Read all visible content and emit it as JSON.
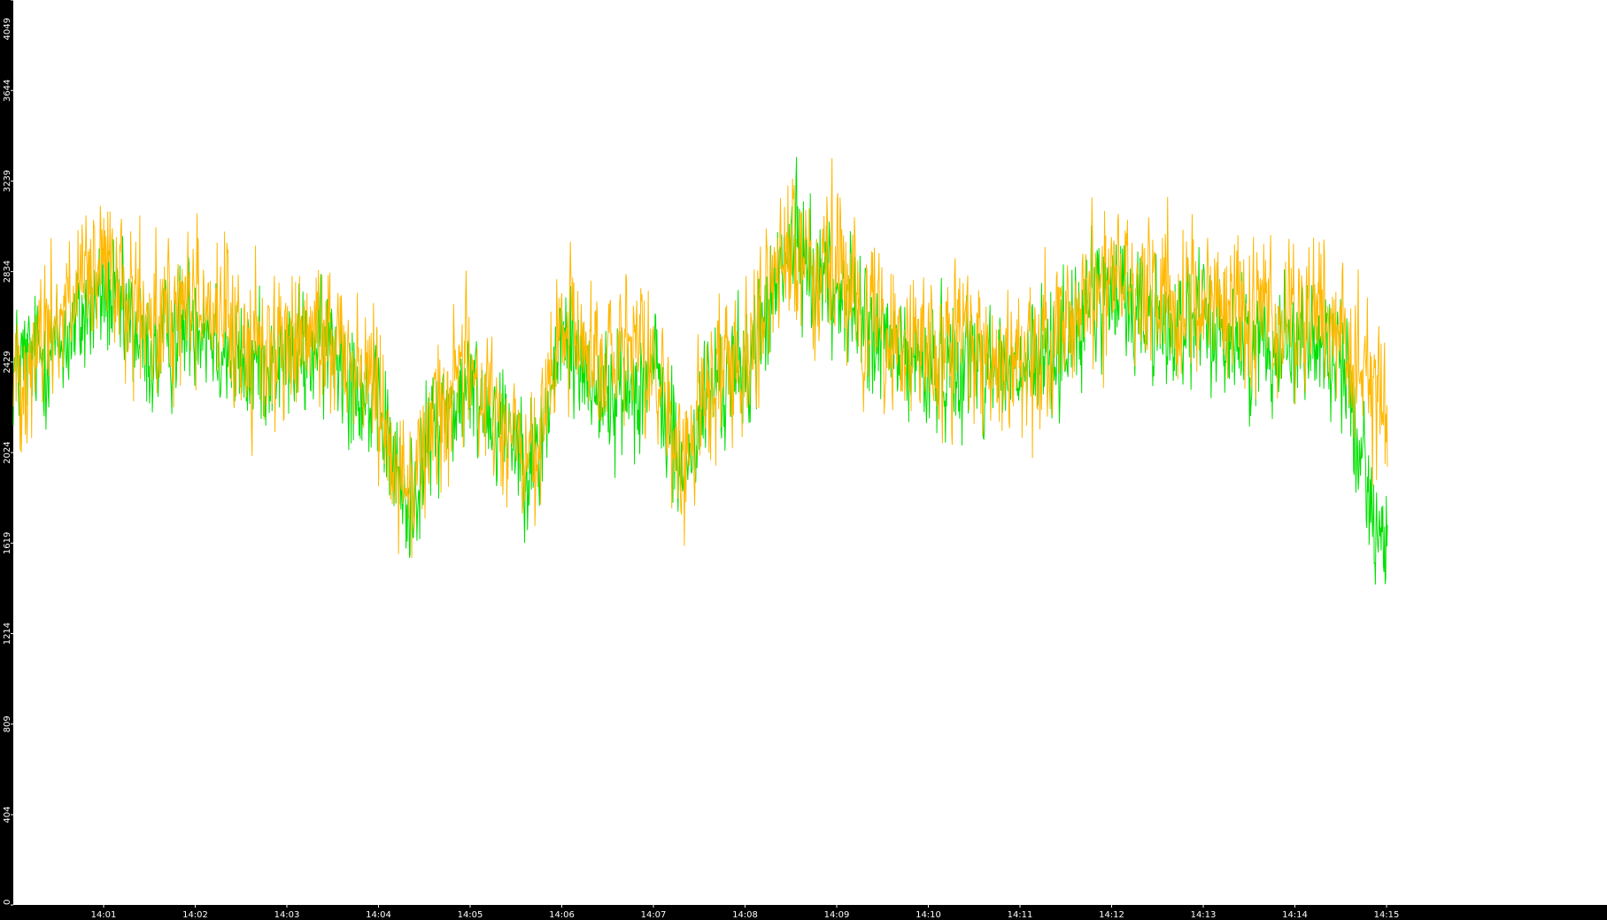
{
  "chart_data": {
    "type": "line",
    "title": "",
    "xlabel": "",
    "ylabel": "",
    "grid": false,
    "legend": "none",
    "background": "#ffffff",
    "frame_color": "#000000",
    "y_ticks": [
      0,
      404,
      809,
      1214,
      1619,
      2024,
      2429,
      2834,
      3239,
      3644,
      4049
    ],
    "y_tick_labels": [
      "0",
      "404",
      "809",
      "1214",
      "1619",
      "2024",
      "2429",
      "2834",
      "3239",
      "3644",
      "4049"
    ],
    "ylim": [
      0,
      4049
    ],
    "x_tick_labels": [
      "14:01",
      "14:02",
      "14:03",
      "14:04",
      "14:05",
      "14:06",
      "14:07",
      "14:08",
      "14:09",
      "14:10",
      "14:11",
      "14:12",
      "14:13",
      "14:14",
      "14:15"
    ],
    "x_ticks_minutes": [
      1,
      2,
      3,
      4,
      5,
      6,
      7,
      8,
      9,
      10,
      11,
      12,
      13,
      14,
      15
    ],
    "xlim_minutes": [
      0.0,
      15.0
    ],
    "samples_per_minute": 160,
    "series": [
      {
        "color": "#00e000",
        "envelope_minutes": [
          0.0,
          0.5,
          1.0,
          1.5,
          2.0,
          2.5,
          3.0,
          3.5,
          4.0,
          4.3,
          4.6,
          5.0,
          5.4,
          5.7,
          6.0,
          6.5,
          7.0,
          7.3,
          7.6,
          8.0,
          8.5,
          9.0,
          9.5,
          10.0,
          10.5,
          11.0,
          11.5,
          12.0,
          12.5,
          13.0,
          13.5,
          14.0,
          14.5,
          15.0
        ],
        "envelope_values": [
          2400,
          2500,
          2750,
          2450,
          2650,
          2400,
          2450,
          2500,
          2200,
          1750,
          2150,
          2300,
          2150,
          1950,
          2550,
          2250,
          2400,
          1900,
          2300,
          2400,
          2950,
          2750,
          2500,
          2400,
          2450,
          2350,
          2550,
          2750,
          2600,
          2600,
          2500,
          2550,
          2450,
          1500
        ],
        "spread": 520
      },
      {
        "color": "#ffb800",
        "envelope_minutes": [
          0.0,
          0.5,
          1.0,
          1.5,
          2.0,
          2.5,
          3.0,
          3.5,
          4.0,
          4.3,
          4.6,
          5.0,
          5.4,
          5.7,
          6.0,
          6.5,
          7.0,
          7.3,
          7.6,
          8.0,
          8.5,
          9.0,
          9.5,
          10.0,
          10.5,
          11.0,
          11.5,
          12.0,
          12.5,
          13.0,
          13.5,
          14.0,
          14.5,
          15.0
        ],
        "envelope_values": [
          2350,
          2650,
          2850,
          2550,
          2750,
          2500,
          2500,
          2550,
          2300,
          1800,
          2200,
          2400,
          2100,
          1950,
          2600,
          2400,
          2450,
          1900,
          2350,
          2500,
          2950,
          2800,
          2550,
          2450,
          2500,
          2350,
          2600,
          2850,
          2750,
          2700,
          2650,
          2600,
          2600,
          2200
        ],
        "spread": 620
      }
    ]
  }
}
